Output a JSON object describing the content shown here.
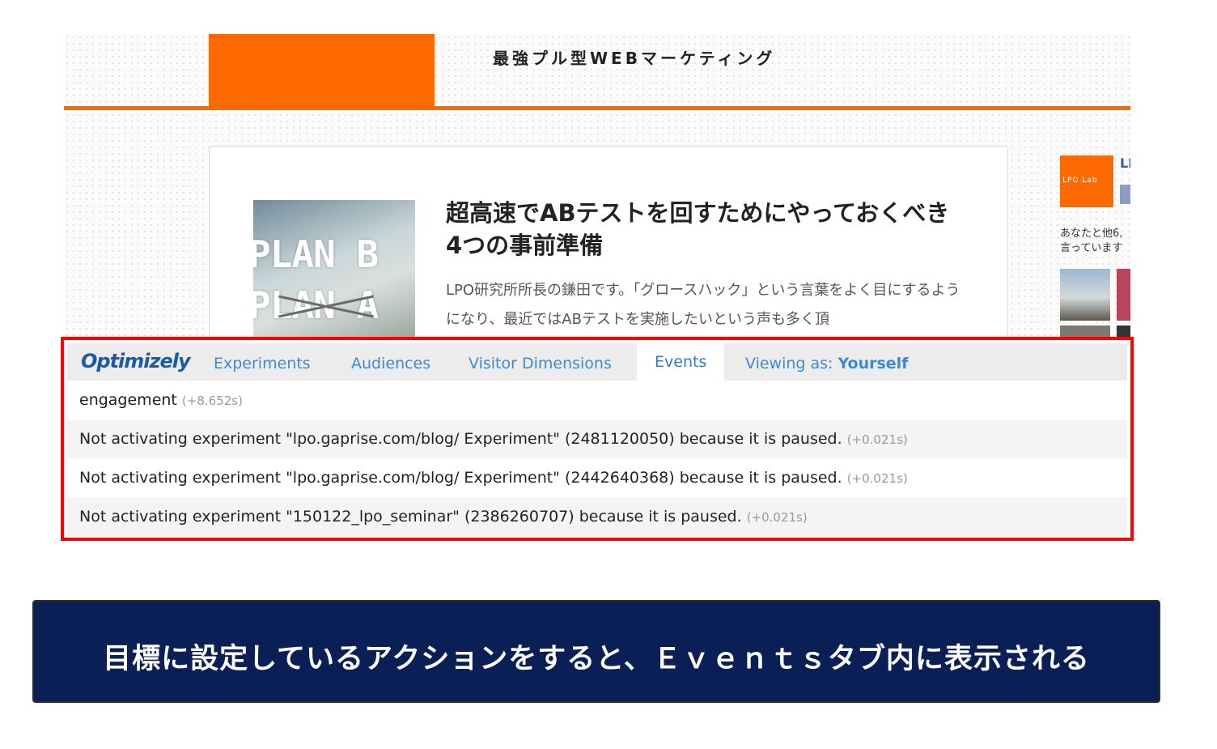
{
  "site": {
    "tagline": "最強プル型WEBマーケティング",
    "brand_color": "#ff6a00"
  },
  "article": {
    "title": "超高速でABテストを回すためにやっておくべき4つの事前準備",
    "excerpt": "LPO研究所所長の鎌田です。「グロースハック」という言葉をよく目にするようになり、最近ではABテストを実施したいという声も多く頂",
    "thumbnail_line1": "PLAN B",
    "thumbnail_line2": "PLAN A"
  },
  "sidebar": {
    "logo_text": "LPO Lab",
    "page_name": "LI",
    "like_text": "あなたと他6,言っています"
  },
  "optimizely": {
    "logo": "Optimizely",
    "tabs": [
      "Experiments",
      "Audiences",
      "Visitor Dimensions",
      "Events"
    ],
    "active_tab": "Events",
    "viewing_as_label": "Viewing as:",
    "viewing_as_value": "Yourself",
    "events": [
      {
        "text": "engagement",
        "time": "(+8.652s)"
      },
      {
        "text": "Not activating experiment \"lpo.gaprise.com/blog/ Experiment\" (2481120050) because it is paused.",
        "time": "(+0.021s)"
      },
      {
        "text": "Not activating experiment \"lpo.gaprise.com/blog/ Experiment\" (2442640368) because it is paused.",
        "time": "(+0.021s)"
      },
      {
        "text": "Not activating experiment \"150122_lpo_seminar\" (2386260707) because it is paused.",
        "time": "(+0.021s)"
      }
    ],
    "highlight_color": "#ff0000"
  },
  "caption": {
    "text": "目標に設定しているアクションをすると、Ｅｖｅｎｔｓタブ内に表示される",
    "background": "#0b1f57"
  }
}
